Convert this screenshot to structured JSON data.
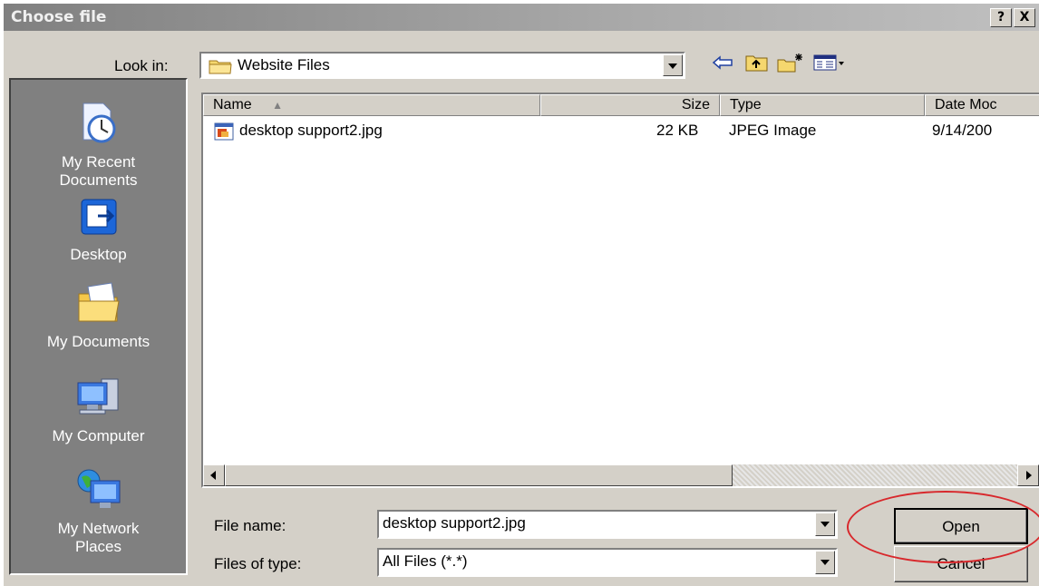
{
  "window": {
    "title": "Choose file",
    "help_label": "?",
    "close_label": "X"
  },
  "look_in": {
    "label": "Look in:",
    "value": "Website Files",
    "folder_icon": "folder-icon"
  },
  "toolbar": {
    "back_icon": "back-arrow-icon",
    "up_icon": "up-folder-icon",
    "new_folder_icon": "new-folder-icon",
    "views_icon": "views-menu-icon"
  },
  "places": [
    {
      "label_1": "My Recent",
      "label_2": "Documents",
      "icon": "recent-documents-icon"
    },
    {
      "label_1": "Desktop",
      "label_2": "",
      "icon": "desktop-icon"
    },
    {
      "label_1": "My Documents",
      "label_2": "",
      "icon": "my-documents-icon"
    },
    {
      "label_1": "My Computer",
      "label_2": "",
      "icon": "my-computer-icon"
    },
    {
      "label_1": "My Network",
      "label_2": "Places",
      "icon": "network-places-icon"
    }
  ],
  "columns": {
    "name": "Name",
    "size": "Size",
    "type": "Type",
    "date": "Date Moc"
  },
  "files": [
    {
      "name": "desktop support2.jpg",
      "size": "22 KB",
      "type": "JPEG Image",
      "date": "9/14/200",
      "icon": "jpeg-file-icon"
    }
  ],
  "file_name": {
    "label": "File name:",
    "value": "desktop support2.jpg"
  },
  "file_type": {
    "label": "Files of type:",
    "value": "All Files (*.*)"
  },
  "buttons": {
    "open": "Open",
    "cancel": "Cancel"
  },
  "colors": {
    "annotation": "#d8282c",
    "dialog_face": "#d4d0c8"
  }
}
